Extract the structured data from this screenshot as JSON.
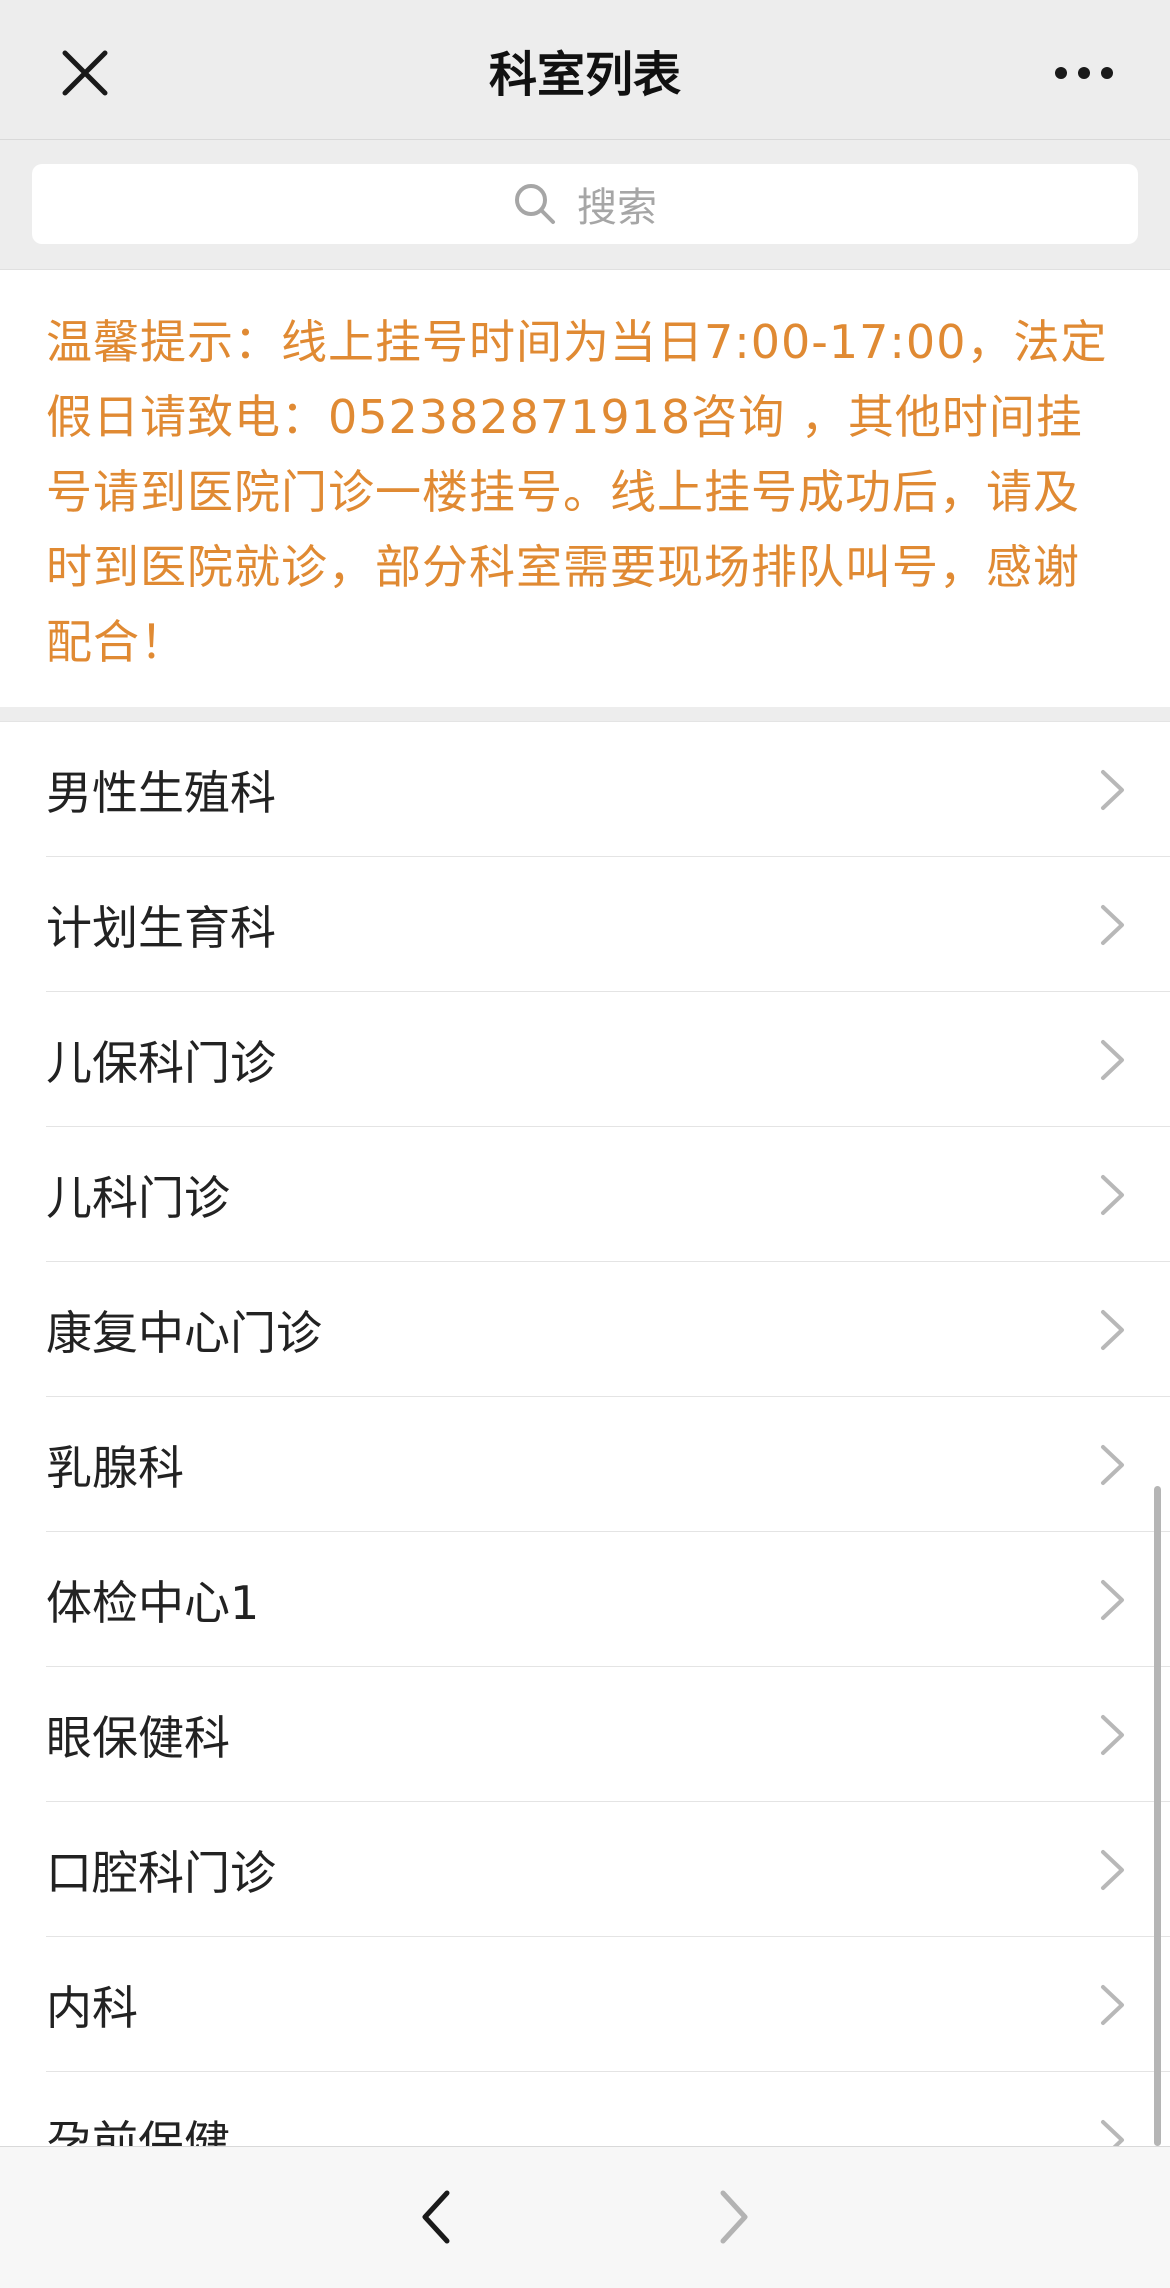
{
  "navbar": {
    "title": "科室列表",
    "close_icon": "close-icon",
    "more_icon": "more-dots-icon"
  },
  "search": {
    "placeholder": "搜索",
    "icon": "search-icon"
  },
  "notice": {
    "text": "温馨提示：线上挂号时间为当日7:00-17:00，法定假日请致电：052382871918咨询 ，其他时间挂号请到医院门诊一楼挂号。线上挂号成功后，请及时到医院就诊，部分科室需要现场排队叫号，感谢配合！",
    "color": "#e08a33"
  },
  "departments": [
    {
      "label": "男性生殖科"
    },
    {
      "label": "计划生育科"
    },
    {
      "label": "儿保科门诊"
    },
    {
      "label": "儿科门诊"
    },
    {
      "label": "康复中心门诊"
    },
    {
      "label": "乳腺科"
    },
    {
      "label": "体检中心1"
    },
    {
      "label": "眼保健科"
    },
    {
      "label": "口腔科门诊"
    },
    {
      "label": "内科"
    },
    {
      "label": "孕前保健"
    }
  ],
  "toolbar": {
    "back_icon": "chevron-left-icon",
    "forward_icon": "chevron-right-icon"
  }
}
